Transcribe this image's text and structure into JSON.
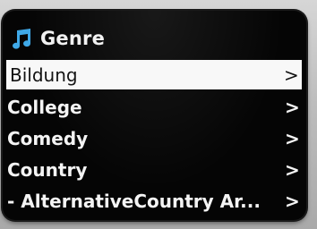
{
  "header": {
    "title": "Genre",
    "icon": "music-note-icon",
    "icon_color": "#3fa9e8"
  },
  "menu": {
    "items": [
      {
        "label": "Bildung",
        "arrow": ">",
        "selected": true
      },
      {
        "label": "College",
        "arrow": ">",
        "selected": false
      },
      {
        "label": "Comedy",
        "arrow": ">",
        "selected": false
      },
      {
        "label": "Country",
        "arrow": ">",
        "selected": false
      },
      {
        "label": "- AlternativeCountry Ar...",
        "arrow": ">",
        "selected": false
      }
    ]
  },
  "colors": {
    "screen_bg": "#050505",
    "text": "#f4f4f4",
    "selected_bg": "#f8f8f8",
    "selected_text": "#111111"
  }
}
